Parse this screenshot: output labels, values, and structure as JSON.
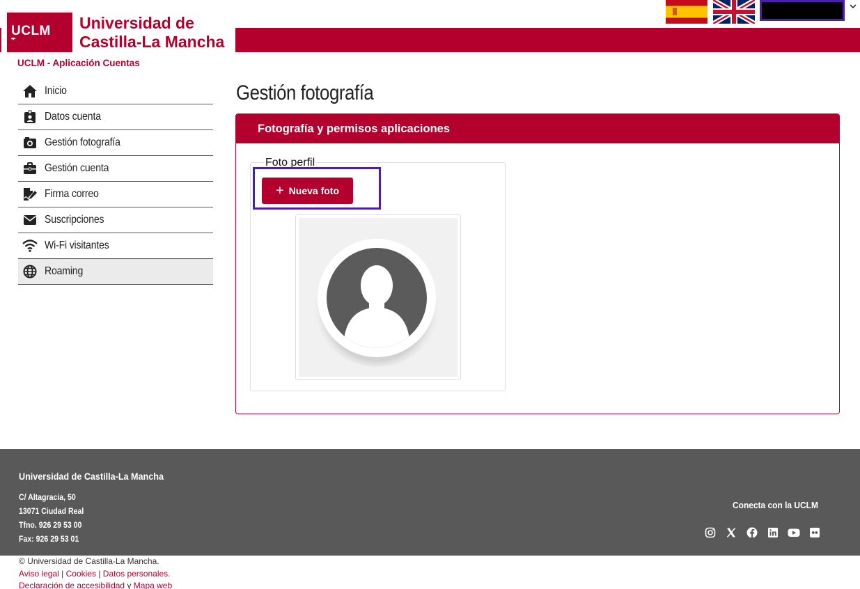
{
  "header": {
    "logo_text": "UCLM",
    "university_line1": "Universidad de",
    "university_line2": "Castilla-La Mancha",
    "app_title": "UCLM - Aplicación Cuentas"
  },
  "colors": {
    "brand": "#b3002d",
    "highlight": "#4b1eb0",
    "footer": "#595959"
  },
  "sidebar": {
    "items": [
      {
        "label": "Inicio",
        "icon": "home-icon"
      },
      {
        "label": "Datos cuenta",
        "icon": "id-badge-icon"
      },
      {
        "label": "Gestión fotografía",
        "icon": "camera-icon"
      },
      {
        "label": "Gestión cuenta",
        "icon": "briefcase-icon"
      },
      {
        "label": "Firma correo",
        "icon": "signature-icon"
      },
      {
        "label": "Suscripciones",
        "icon": "envelope-icon"
      },
      {
        "label": "Wi-Fi visitantes",
        "icon": "wifi-icon"
      },
      {
        "label": "Roaming",
        "icon": "globe-icon"
      }
    ]
  },
  "main": {
    "page_title": "Gestión fotografía",
    "panel_title": "Fotografía y permisos aplicaciones",
    "subpanel_title": "Foto perfil",
    "new_photo_label": "Nueva foto"
  },
  "footer": {
    "name": "Universidad de Castilla-La Mancha",
    "address": "C/ Altagracia, 50",
    "city": "13071 Ciudad Real",
    "phone": "Tfno. 926 29 53 00",
    "fax": "Fax: 926 29 53 01",
    "connect": "Conecta con la UCLM",
    "social": [
      "instagram-icon",
      "x-icon",
      "facebook-icon",
      "linkedin-icon",
      "youtube-icon",
      "flickr-icon"
    ]
  },
  "bottom": {
    "copyright": "© Universidad de Castilla-La Mancha.",
    "aviso": "Aviso legal",
    "cookies": "Cookies",
    "datos": "Datos personales.",
    "accesibilidad": "Declaración de accesibilidad",
    "y": "y",
    "mapa": "Mapa web"
  }
}
